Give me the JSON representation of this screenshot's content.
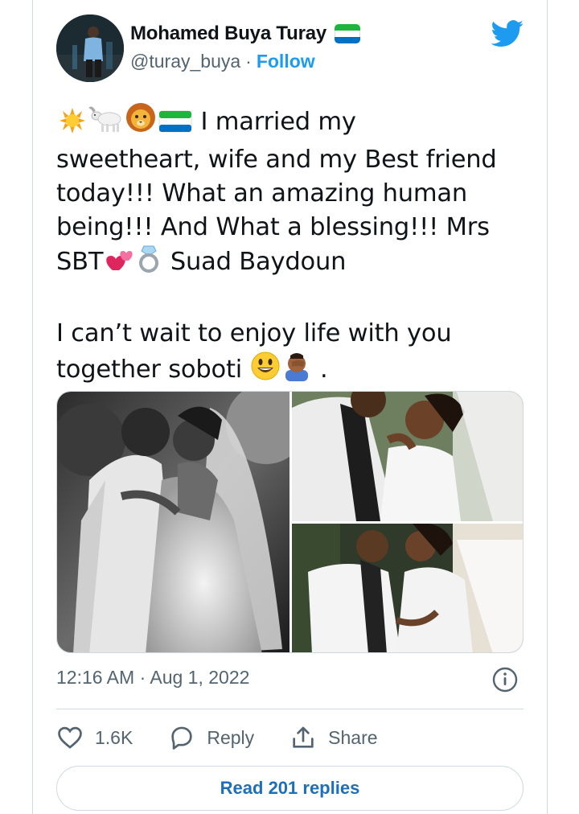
{
  "user": {
    "display_name": "Mohamed Buya Turay",
    "handle": "@turay_buya",
    "separator": "·",
    "follow_label": "Follow",
    "flag_icon": "sierra-leone-flag-icon"
  },
  "tweet": {
    "line1_text": " I married my",
    "line2_text": "sweetheart, wife and my Best friend",
    "line3_text": "today!!! What an amazing human",
    "line4_text": "being!!! And What a blessing!!! Mrs",
    "line5_prefix": "SBT",
    "line5_suffix": " Suad Baydoun",
    "line6_text": "I can’t wait to enjoy life with you",
    "line7_prefix": "together soboti ",
    "line7_suffix": " .",
    "emojis": [
      "sun-emoji",
      "goat-emoji",
      "lion-emoji",
      "sierra-leone-flag-emoji",
      "two-hearts-emoji",
      "ring-emoji",
      "smiley-emoji",
      "facepalm-emoji"
    ]
  },
  "media": {
    "photos": [
      "wedding-photo-couple-embrace-bw",
      "wedding-photo-kiss-closeup",
      "wedding-photo-kiss-outdoor"
    ]
  },
  "meta": {
    "timestamp": "12:16 AM · Aug 1, 2022"
  },
  "actions": {
    "like_count": "1.6K",
    "reply_label": "Reply",
    "share_label": "Share"
  },
  "footer": {
    "read_replies_label": "Read 201 replies"
  },
  "colors": {
    "accent": "#1d9bf0",
    "text": "#0f1419",
    "secondary_text": "#536471",
    "border": "#cfd9de"
  }
}
